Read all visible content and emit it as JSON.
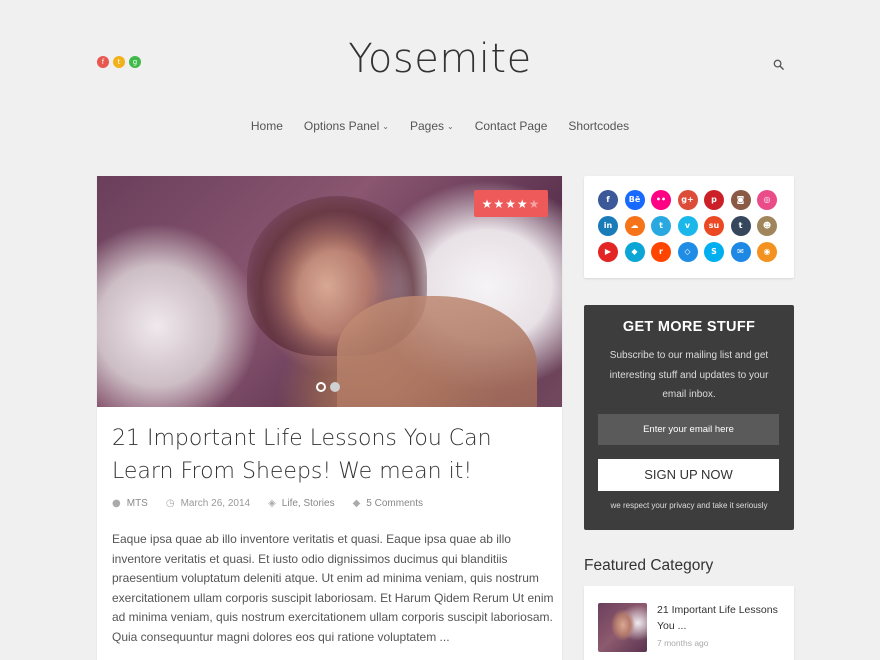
{
  "header": {
    "site_title": "Yosemite",
    "social_top": [
      {
        "icon": "facebook-icon",
        "glyph": "f",
        "color": "#e8584f"
      },
      {
        "icon": "twitter-icon",
        "glyph": "t",
        "color": "#f2b11b"
      },
      {
        "icon": "google-plus-icon",
        "glyph": "g",
        "color": "#3fba4a"
      }
    ]
  },
  "nav": {
    "items": [
      {
        "label": "Home",
        "dropdown": false
      },
      {
        "label": "Options Panel",
        "dropdown": true
      },
      {
        "label": "Pages",
        "dropdown": true
      },
      {
        "label": "Contact Page",
        "dropdown": false
      },
      {
        "label": "Shortcodes",
        "dropdown": false
      }
    ]
  },
  "post": {
    "rating_stars": 4,
    "rating_max": 5,
    "slider": {
      "count": 2,
      "active": 0
    },
    "title": "21 Important Life Lessons You Can Learn From Sheeps! We mean it!",
    "author": "MTS",
    "date": "March 26, 2014",
    "categories": "Life, Stories",
    "comments": "5 Comments",
    "excerpt": "Eaque ipsa quae ab illo inventore veritatis et quasi. Eaque ipsa quae ab illo inventore veritatis et quasi. Et iusto odio dignissimos ducimus qui blanditiis praesentium voluptatum deleniti atque. Ut enim ad minima veniam, quis nostrum exercitationem ullam corporis suscipit laboriosam. Et Harum Qidem Rerum Ut enim ad minima veniam, quis nostrum exercitationem ullam corporis suscipit laboriosam. Quia consequuntur magni dolores eos qui ratione voluptatem ..."
  },
  "social_widget": [
    {
      "icon": "facebook-icon",
      "glyph": "f",
      "color": "#3b5998"
    },
    {
      "icon": "behance-icon",
      "glyph": "Bē",
      "color": "#1769ff"
    },
    {
      "icon": "flickr-icon",
      "glyph": "••",
      "color": "#ff0084"
    },
    {
      "icon": "google-plus-icon",
      "glyph": "g+",
      "color": "#dd4b39"
    },
    {
      "icon": "pinterest-icon",
      "glyph": "p",
      "color": "#cb2027"
    },
    {
      "icon": "instagram-icon",
      "glyph": "◙",
      "color": "#8a5a44"
    },
    {
      "icon": "dribbble-icon",
      "glyph": "◎",
      "color": "#ea4c89"
    },
    {
      "icon": "linkedin-icon",
      "glyph": "in",
      "color": "#1a7bb9"
    },
    {
      "icon": "soundcloud-icon",
      "glyph": "☁",
      "color": "#f7731a"
    },
    {
      "icon": "twitter-icon",
      "glyph": "t",
      "color": "#2aa9e0"
    },
    {
      "icon": "vimeo-icon",
      "glyph": "v",
      "color": "#1ab7ea"
    },
    {
      "icon": "stumbleupon-icon",
      "glyph": "su",
      "color": "#eb4924"
    },
    {
      "icon": "tumblr-icon",
      "glyph": "t",
      "color": "#36465d"
    },
    {
      "icon": "github-icon",
      "glyph": "☻",
      "color": "#a0865c"
    },
    {
      "icon": "youtube-icon",
      "glyph": "▶",
      "color": "#e32524"
    },
    {
      "icon": "delicious-icon",
      "glyph": "◆",
      "color": "#0ca6d6"
    },
    {
      "icon": "reddit-icon",
      "glyph": "r",
      "color": "#ff4500"
    },
    {
      "icon": "dropbox-icon",
      "glyph": "◇",
      "color": "#1f8ce6"
    },
    {
      "icon": "skype-icon",
      "glyph": "S",
      "color": "#00aff0"
    },
    {
      "icon": "email-icon",
      "glyph": "✉",
      "color": "#1e88e5"
    },
    {
      "icon": "rss-icon",
      "glyph": "◉",
      "color": "#f39221"
    }
  ],
  "newsletter": {
    "title": "GET MORE STUFF",
    "description": "Subscribe to our mailing list and get interesting stuff and updates to your email inbox.",
    "email_placeholder": "Enter your email here",
    "button_label": "SIGN UP NOW",
    "privacy": "we respect your privacy and take it seriously"
  },
  "featured": {
    "heading": "Featured Category",
    "item_title": "21 Important Life Lessons You ...",
    "item_date": "7 months ago"
  }
}
